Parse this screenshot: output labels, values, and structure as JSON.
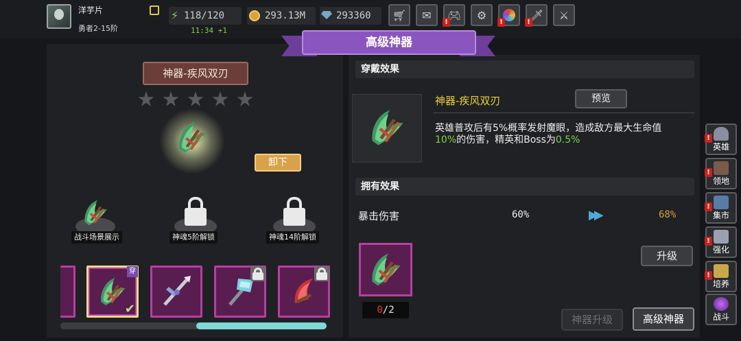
{
  "player": {
    "name": "洋芋片",
    "rank": "勇者2-15阶"
  },
  "resources": {
    "energy": "118/120",
    "energy_timer": "11:34 +1",
    "gold": "293.13M",
    "gems": "293360"
  },
  "top_icons": [
    "shop-cart-icon",
    "mail-icon",
    "gamepad-icon",
    "settings-gear-icon",
    "color-wheel-icon",
    "sword-icon",
    "crossed-swords-icon"
  ],
  "page_title": "高级神器",
  "equipped": {
    "title": "神器-疾风双刃",
    "stars_filled": 0,
    "stars_total": 5,
    "unequip_label": "卸下"
  },
  "slots": [
    {
      "label": "战斗场景展示",
      "locked": false
    },
    {
      "label": "神魂5阶解锁",
      "locked": true
    },
    {
      "label": "神魂14阶解锁",
      "locked": true
    }
  ],
  "carousel": {
    "equipped_badge": "穿",
    "scroll_position": 0.51
  },
  "wear_effect": {
    "header": "穿戴效果",
    "name": "神器-疾风双刃",
    "preview_label": "预览",
    "desc_line1": "英雄普攻后有5%概率发射魔眼，造成敌方最大生命值",
    "desc_highlight1": "10%",
    "desc_mid": "的伤害，精英和Boss为",
    "desc_highlight2": "0.5%"
  },
  "own_effect": {
    "header": "拥有效果",
    "stat_name": "暴击伤害",
    "current": "60%",
    "next": "68%"
  },
  "material": {
    "have": "0",
    "need": "/2"
  },
  "upgrade_label": "升级",
  "bottom_tabs": {
    "artifact_upgrade": "神器升级",
    "advanced_artifact": "高级神器"
  },
  "side_nav": [
    {
      "label": "英雄",
      "icon": "helmet-icon"
    },
    {
      "label": "领地",
      "icon": "castle-icon"
    },
    {
      "label": "集市",
      "icon": "market-icon"
    },
    {
      "label": "强化",
      "icon": "anvil-icon"
    },
    {
      "label": "培养",
      "icon": "trophy-icon"
    },
    {
      "label": "战斗",
      "icon": "portal-icon"
    }
  ],
  "colors": {
    "accent_purple": "#8b55c0",
    "rarity_border": "#b53fa4",
    "positive_green": "#7fd44a",
    "next_value_gold": "#d2a23a",
    "warning_red": "#e23b3b"
  }
}
